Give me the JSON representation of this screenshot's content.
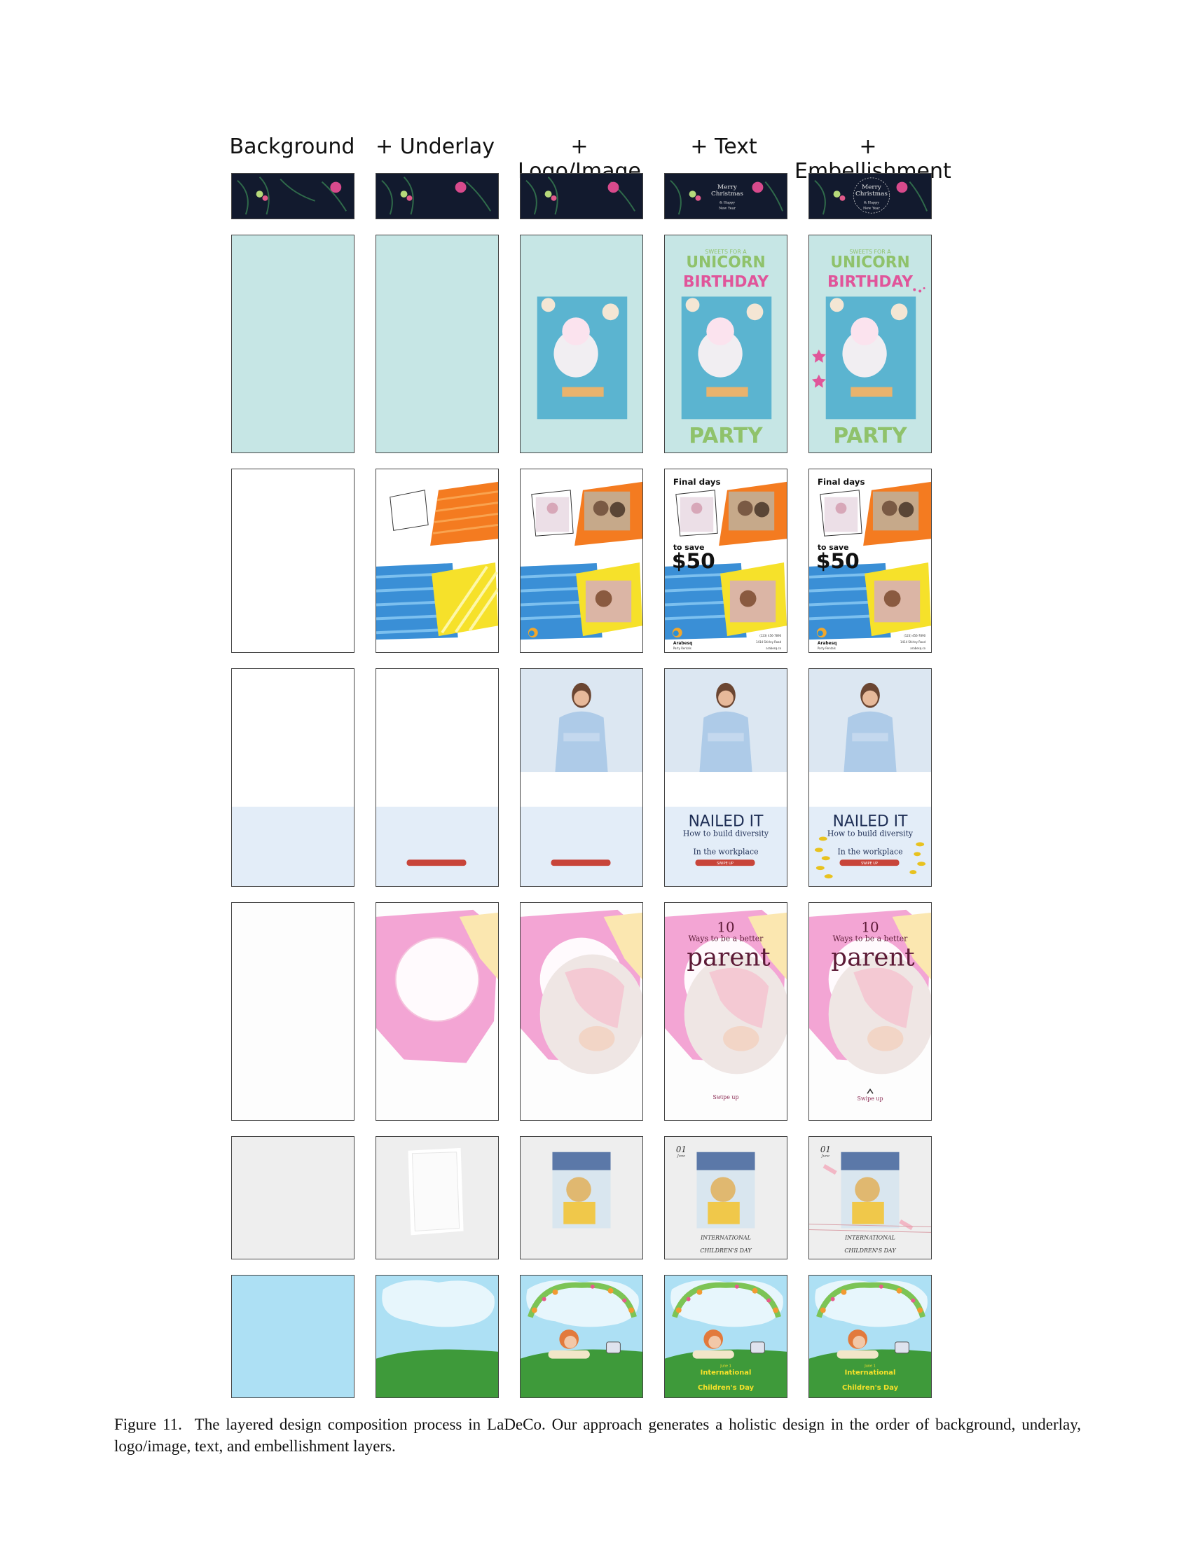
{
  "columns": [
    "Background",
    "+ Underlay",
    "+ Logo/Image",
    "+ Text",
    "+ Embellishment"
  ],
  "rows": [
    {
      "name": "christmas-banner",
      "text": {
        "line1": "Merry",
        "line2": "Christmas",
        "line3": "& Happy",
        "line4": "New Year"
      }
    },
    {
      "name": "unicorn-poster",
      "text": {
        "top": "SWEETS FOR A",
        "title1": "UNICORN",
        "title2": "BIRTHDAY",
        "bottom": "PARTY"
      }
    },
    {
      "name": "sale-poster",
      "text": {
        "head": "Final days",
        "sub": "to save",
        "price": "$50",
        "brand": "Arabesq",
        "brand_sub": "Party Rentals",
        "phone": "(123) 456-7890",
        "address": "1414 Shirley Road",
        "web": "arabesq.co"
      }
    },
    {
      "name": "diversity-post",
      "text": {
        "title": "NAILED IT",
        "line1": "How to build diversity",
        "line2": "In the workplace",
        "cta": "SWIPE UP"
      }
    },
    {
      "name": "parent-post",
      "text": {
        "num": "10",
        "line": "Ways to be a better",
        "word": "parent",
        "cta": "Swipe up"
      }
    },
    {
      "name": "childrens-day-card",
      "text": {
        "date1": "01",
        "date2": "June",
        "line1": "INTERNATIONAL",
        "line2": "CHILDREN'S DAY"
      }
    },
    {
      "name": "childrens-day-scene",
      "text": {
        "small": "June 1",
        "line1": "International",
        "line2": "Children's Day"
      }
    }
  ],
  "caption": {
    "label": "Figure 11.",
    "text": "The layered design composition process in LaDeCo. Our approach generates a holistic design in the order of background, underlay, logo/image, text, and embellishment layers."
  },
  "colors": {
    "navy": "#121a2e",
    "mint": "#c6e6e5",
    "sky": "#ade0f4",
    "grass": "#3e9a3a",
    "red": "#c8453a",
    "pink": "#e0559a",
    "green": "#8fc26b"
  }
}
